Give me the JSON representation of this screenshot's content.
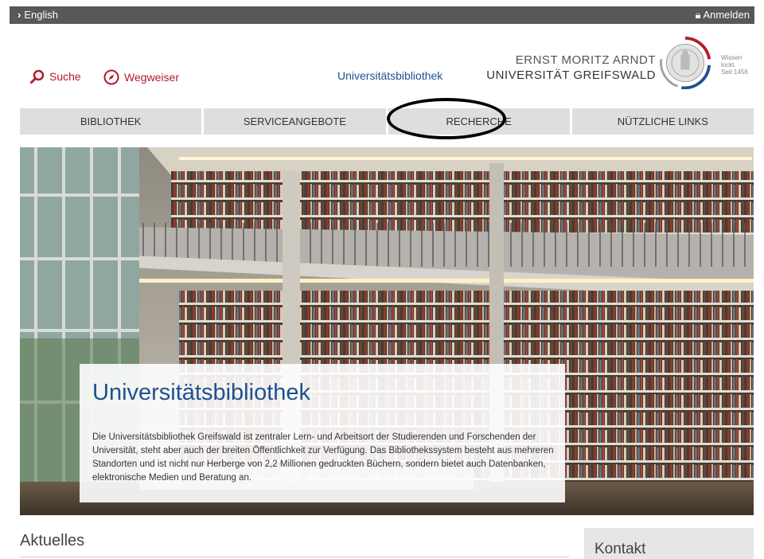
{
  "topbar": {
    "language": "English",
    "login": "Anmelden"
  },
  "header": {
    "search": "Suche",
    "guide": "Wegweiser",
    "library_title": "Universitätsbibliothek",
    "university_line1": "ERNST MORITZ ARNDT",
    "university_line2": "UNIVERSITÄT GREIFSWALD",
    "motto_line1": "Wissen",
    "motto_line2": "lockt.",
    "motto_line3": "Seit 1456"
  },
  "nav": [
    "BIBLIOTHEK",
    "SERVICEANGEBOTE",
    "RECHERCHE",
    "NÜTZLICHE LINKS"
  ],
  "hero": {
    "title": "Universitätsbibliothek",
    "text": "Die Universitätsbibliothek Greifswald ist zentraler Lern- und Arbeitsort der Studierenden und Forschenden der Universität, steht aber auch der breiten Öffentlichkeit zur Verfügung. Das Bibliothekssystem besteht aus mehreren Standorten und ist nicht nur Herberge von 2,2 Millionen gedruckten Büchern, sondern bietet auch Datenbanken, elektronische Medien und Beratung an."
  },
  "aktuelles": "Aktuelles",
  "kontakt": "Kontakt",
  "colors": {
    "accent_red": "#b31b2c",
    "brand_blue": "#1d5190",
    "topbar": "#585858"
  }
}
